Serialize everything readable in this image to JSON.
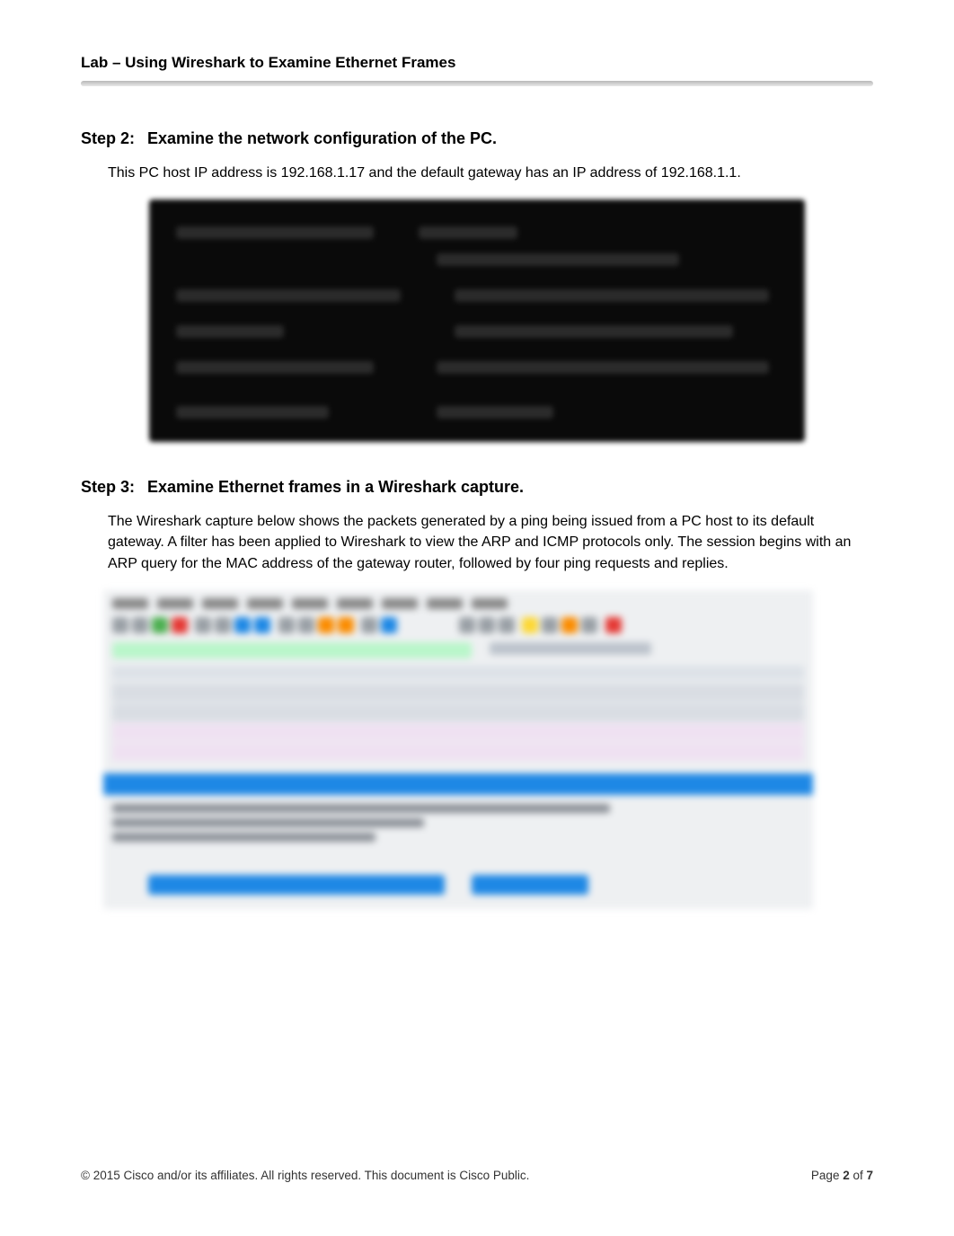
{
  "header": {
    "title": "Lab – Using Wireshark to Examine Ethernet Frames"
  },
  "step2": {
    "label": "Step 2:",
    "heading": "Examine the network configuration of the PC.",
    "text": "This PC host IP address is 192.168.1.17 and the default gateway has an IP address of 192.168.1.1."
  },
  "step3": {
    "label": "Step 3:",
    "heading": "Examine Ethernet frames in a Wireshark capture.",
    "text": "The Wireshark capture below shows the packets generated by a ping being issued from a PC host to its default gateway. A filter has been applied to Wireshark to view the ARP and ICMP protocols only. The session begins with an ARP query for the MAC address of the gateway router, followed by four ping requests and replies."
  },
  "footer": {
    "copyright": "© 2015 Cisco and/or its affiliates. All rights reserved. This document is Cisco Public.",
    "page_prefix": "Page ",
    "page_current": "2",
    "page_sep": " of ",
    "page_total": "7"
  }
}
